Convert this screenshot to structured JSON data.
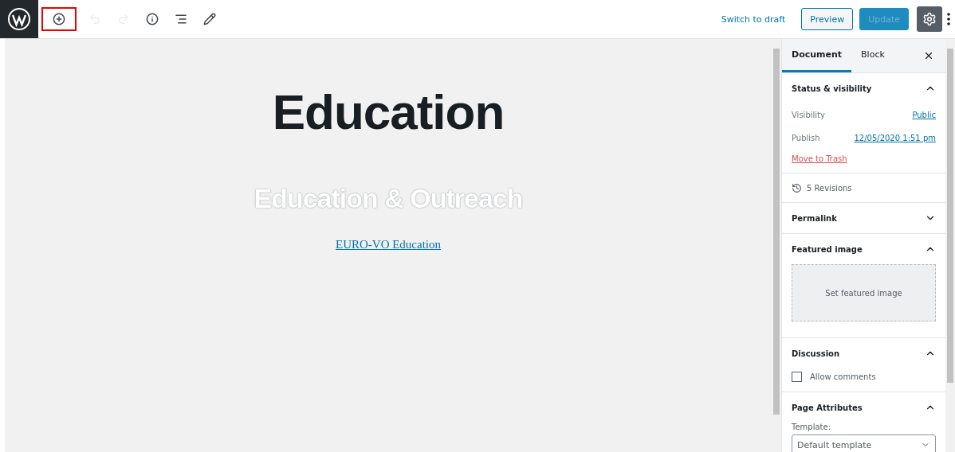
{
  "toolbar": {
    "tools": [
      {
        "kind": "add",
        "disabled": false,
        "highlighted": true
      },
      {
        "kind": "undo",
        "disabled": true,
        "highlighted": false
      },
      {
        "kind": "redo",
        "disabled": true,
        "highlighted": false
      },
      {
        "kind": "info",
        "disabled": false,
        "highlighted": false
      },
      {
        "kind": "outline",
        "disabled": false,
        "highlighted": false
      },
      {
        "kind": "edit",
        "disabled": false,
        "highlighted": false
      }
    ],
    "switch_link": "Switch to draft",
    "preview_button": "Preview",
    "update_button": {
      "label": "Update",
      "disabled": true
    },
    "settings_active": true
  },
  "editor": {
    "title": "Education",
    "subtitle": "Education & Outreach",
    "link": "EURO-VO Education"
  },
  "sidebar": {
    "tabs": [
      {
        "label": "Document",
        "selected": true
      },
      {
        "label": "Block",
        "selected": false
      }
    ],
    "panels": [
      {
        "kind": "status",
        "title": "Status & visibility",
        "expanded": true,
        "rows": [
          {
            "label": "Visibility",
            "value": "Public"
          },
          {
            "label": "Publish",
            "value": "12/05/2020 1:51 pm"
          }
        ],
        "trash": "Move to Trash"
      },
      {
        "kind": "revisions",
        "label": "5 Revisions"
      },
      {
        "kind": "simple",
        "title": "Permalink",
        "expanded": false
      },
      {
        "kind": "image",
        "title": "Featured image",
        "expanded": true,
        "button": "Set featured image"
      },
      {
        "kind": "discussion",
        "title": "Discussion",
        "expanded": true,
        "checkbox": {
          "label": "Allow comments",
          "checked": false
        }
      },
      {
        "kind": "attributes",
        "title": "Page Attributes",
        "expanded": true,
        "field_label": "Template:",
        "value": "Default template"
      }
    ]
  }
}
